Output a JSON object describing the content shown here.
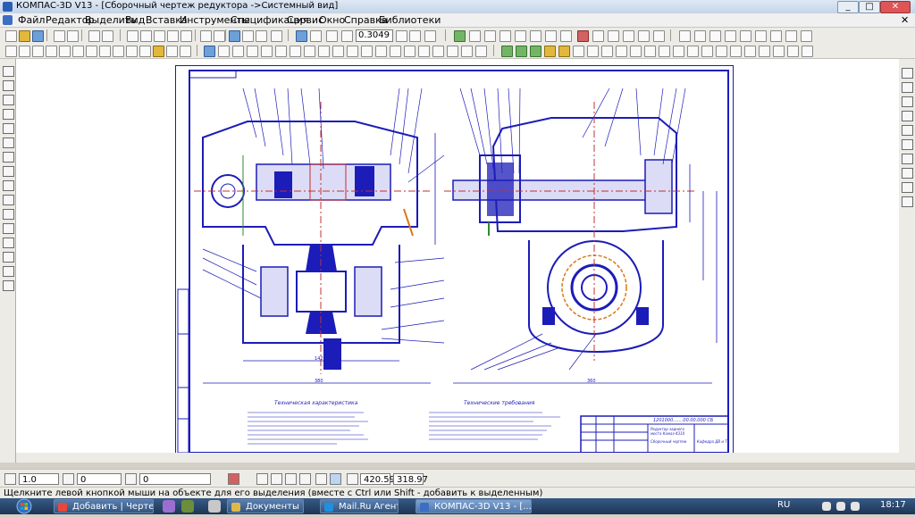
{
  "window": {
    "title": "КОМПАС-3D V13 - [Сборочный чертеж редуктора ->Системный вид]",
    "minimize": "_",
    "maximize": "□",
    "close": "✕"
  },
  "menu": {
    "items": [
      "Файл",
      "Редактор",
      "Выделить",
      "Вид",
      "Вставка",
      "Инструменты",
      "Спецификация",
      "Сервис",
      "Окно",
      "Справка",
      "Библиотеки"
    ],
    "close": "✕"
  },
  "toolbar": {
    "zoom_value": "0.3049"
  },
  "drawing": {
    "left_caption": "Техническая характеристика",
    "right_caption": "Технические требования",
    "dim_left": "142",
    "dim_left_total": "380",
    "dim_right_total": "360",
    "title_block_code": "1201000.......00.00.000 СБ",
    "title_block_name": "Редуктор заднего моста Камаз-4310",
    "title_block_type": "Сборочный чертеж",
    "title_block_org": "Кафедра ДВ и Т"
  },
  "properties": {
    "line_scale": "1.0",
    "layer_value": "0",
    "style_value": "0",
    "x_value": "420.59",
    "y_value": "318.97"
  },
  "status": {
    "text": "Щелкните левой кнопкой мыши на объекте для его выделения (вместе с Ctrl или Shift - добавить к выделенным)"
  },
  "taskbar": {
    "tasks": [
      "Добавить | Чертежи...",
      "Документы",
      "Mail.Ru Агент",
      "КОМПАС-3D V13 - [..."
    ],
    "lang": "RU",
    "time": "18:17"
  },
  "colors": {
    "drawing_blue": "#1c1cb8",
    "drawing_red": "#c43030",
    "drawing_green": "#2e8b2e",
    "drawing_orange": "#d97a18"
  }
}
